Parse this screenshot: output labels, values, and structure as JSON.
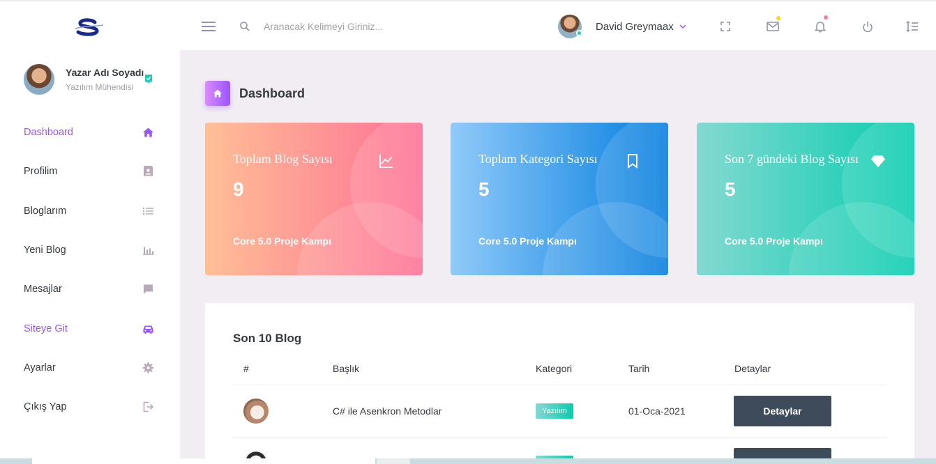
{
  "topbar": {
    "search_placeholder": "Aranacak Kelimeyi Giriniz...",
    "user_name": "David Greymaax",
    "icons": [
      "menu-icon",
      "search-icon",
      "fullscreen-icon",
      "mail-icon",
      "bell-icon",
      "power-icon",
      "list-settings-icon"
    ],
    "badge_colors": {
      "mail": "#fed713",
      "bell": "#fe7c96"
    }
  },
  "sidebar": {
    "profile_name": "Yazar Adı Soyadı",
    "profile_role": "Yazılım Mühendisi",
    "items": [
      {
        "label": "Dashboard",
        "icon": "home-icon"
      },
      {
        "label": "Profilim",
        "icon": "contact-card-icon"
      },
      {
        "label": "Bloglarım",
        "icon": "list-icon"
      },
      {
        "label": "Yeni Blog",
        "icon": "bar-chart-icon"
      },
      {
        "label": "Mesajlar",
        "icon": "message-icon"
      },
      {
        "label": "Siteye Git",
        "icon": "car-icon"
      },
      {
        "label": "Ayarlar",
        "icon": "gear-icon"
      },
      {
        "label": "Çıkış Yap",
        "icon": "logout-icon"
      }
    ]
  },
  "page": {
    "title": "Dashboard"
  },
  "cards": [
    {
      "title": "Toplam Blog Sayısı",
      "value": "9",
      "footer": "Core 5.0 Proje Kampı",
      "icon": "chart-line-icon",
      "colors": [
        "#ffbf96",
        "#fe7096"
      ]
    },
    {
      "title": "Toplam Kategori Sayısı",
      "value": "5",
      "footer": "Core 5.0 Proje Kampı",
      "icon": "bookmark-icon",
      "colors": [
        "#90caf9",
        "#047edf"
      ]
    },
    {
      "title": "Son 7 gündeki Blog Sayısı",
      "value": "5",
      "footer": "Core 5.0 Proje Kampı",
      "icon": "diamond-icon",
      "colors": [
        "#84d9d2",
        "#07cdae"
      ]
    }
  ],
  "table": {
    "title": "Son 10 Blog",
    "headers": [
      "#",
      "Başlık",
      "Kategori",
      "Tarih",
      "Detaylar"
    ],
    "rows": [
      {
        "title": "C# ile Asenkron Metodlar",
        "category": "Yazılım",
        "date": "01-Oca-2021",
        "button": "Detaylar"
      }
    ]
  }
}
